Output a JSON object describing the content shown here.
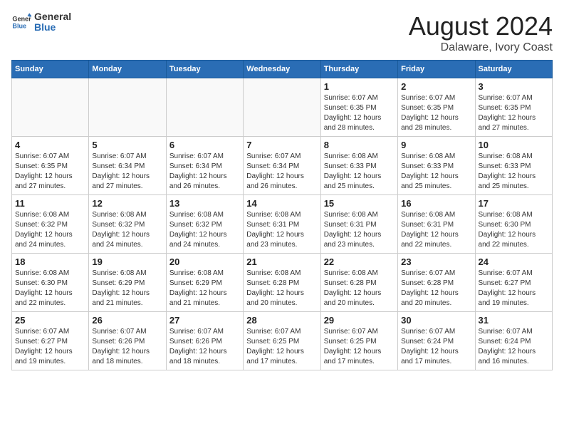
{
  "header": {
    "logo_line1": "General",
    "logo_line2": "Blue",
    "main_title": "August 2024",
    "subtitle": "Dalaware, Ivory Coast"
  },
  "calendar": {
    "weekdays": [
      "Sunday",
      "Monday",
      "Tuesday",
      "Wednesday",
      "Thursday",
      "Friday",
      "Saturday"
    ],
    "weeks": [
      [
        {
          "num": "",
          "info": ""
        },
        {
          "num": "",
          "info": ""
        },
        {
          "num": "",
          "info": ""
        },
        {
          "num": "",
          "info": ""
        },
        {
          "num": "1",
          "info": "Sunrise: 6:07 AM\nSunset: 6:35 PM\nDaylight: 12 hours\nand 28 minutes."
        },
        {
          "num": "2",
          "info": "Sunrise: 6:07 AM\nSunset: 6:35 PM\nDaylight: 12 hours\nand 28 minutes."
        },
        {
          "num": "3",
          "info": "Sunrise: 6:07 AM\nSunset: 6:35 PM\nDaylight: 12 hours\nand 27 minutes."
        }
      ],
      [
        {
          "num": "4",
          "info": "Sunrise: 6:07 AM\nSunset: 6:35 PM\nDaylight: 12 hours\nand 27 minutes."
        },
        {
          "num": "5",
          "info": "Sunrise: 6:07 AM\nSunset: 6:34 PM\nDaylight: 12 hours\nand 27 minutes."
        },
        {
          "num": "6",
          "info": "Sunrise: 6:07 AM\nSunset: 6:34 PM\nDaylight: 12 hours\nand 26 minutes."
        },
        {
          "num": "7",
          "info": "Sunrise: 6:07 AM\nSunset: 6:34 PM\nDaylight: 12 hours\nand 26 minutes."
        },
        {
          "num": "8",
          "info": "Sunrise: 6:08 AM\nSunset: 6:33 PM\nDaylight: 12 hours\nand 25 minutes."
        },
        {
          "num": "9",
          "info": "Sunrise: 6:08 AM\nSunset: 6:33 PM\nDaylight: 12 hours\nand 25 minutes."
        },
        {
          "num": "10",
          "info": "Sunrise: 6:08 AM\nSunset: 6:33 PM\nDaylight: 12 hours\nand 25 minutes."
        }
      ],
      [
        {
          "num": "11",
          "info": "Sunrise: 6:08 AM\nSunset: 6:32 PM\nDaylight: 12 hours\nand 24 minutes."
        },
        {
          "num": "12",
          "info": "Sunrise: 6:08 AM\nSunset: 6:32 PM\nDaylight: 12 hours\nand 24 minutes."
        },
        {
          "num": "13",
          "info": "Sunrise: 6:08 AM\nSunset: 6:32 PM\nDaylight: 12 hours\nand 24 minutes."
        },
        {
          "num": "14",
          "info": "Sunrise: 6:08 AM\nSunset: 6:31 PM\nDaylight: 12 hours\nand 23 minutes."
        },
        {
          "num": "15",
          "info": "Sunrise: 6:08 AM\nSunset: 6:31 PM\nDaylight: 12 hours\nand 23 minutes."
        },
        {
          "num": "16",
          "info": "Sunrise: 6:08 AM\nSunset: 6:31 PM\nDaylight: 12 hours\nand 22 minutes."
        },
        {
          "num": "17",
          "info": "Sunrise: 6:08 AM\nSunset: 6:30 PM\nDaylight: 12 hours\nand 22 minutes."
        }
      ],
      [
        {
          "num": "18",
          "info": "Sunrise: 6:08 AM\nSunset: 6:30 PM\nDaylight: 12 hours\nand 22 minutes."
        },
        {
          "num": "19",
          "info": "Sunrise: 6:08 AM\nSunset: 6:29 PM\nDaylight: 12 hours\nand 21 minutes."
        },
        {
          "num": "20",
          "info": "Sunrise: 6:08 AM\nSunset: 6:29 PM\nDaylight: 12 hours\nand 21 minutes."
        },
        {
          "num": "21",
          "info": "Sunrise: 6:08 AM\nSunset: 6:28 PM\nDaylight: 12 hours\nand 20 minutes."
        },
        {
          "num": "22",
          "info": "Sunrise: 6:08 AM\nSunset: 6:28 PM\nDaylight: 12 hours\nand 20 minutes."
        },
        {
          "num": "23",
          "info": "Sunrise: 6:07 AM\nSunset: 6:28 PM\nDaylight: 12 hours\nand 20 minutes."
        },
        {
          "num": "24",
          "info": "Sunrise: 6:07 AM\nSunset: 6:27 PM\nDaylight: 12 hours\nand 19 minutes."
        }
      ],
      [
        {
          "num": "25",
          "info": "Sunrise: 6:07 AM\nSunset: 6:27 PM\nDaylight: 12 hours\nand 19 minutes."
        },
        {
          "num": "26",
          "info": "Sunrise: 6:07 AM\nSunset: 6:26 PM\nDaylight: 12 hours\nand 18 minutes."
        },
        {
          "num": "27",
          "info": "Sunrise: 6:07 AM\nSunset: 6:26 PM\nDaylight: 12 hours\nand 18 minutes."
        },
        {
          "num": "28",
          "info": "Sunrise: 6:07 AM\nSunset: 6:25 PM\nDaylight: 12 hours\nand 17 minutes."
        },
        {
          "num": "29",
          "info": "Sunrise: 6:07 AM\nSunset: 6:25 PM\nDaylight: 12 hours\nand 17 minutes."
        },
        {
          "num": "30",
          "info": "Sunrise: 6:07 AM\nSunset: 6:24 PM\nDaylight: 12 hours\nand 17 minutes."
        },
        {
          "num": "31",
          "info": "Sunrise: 6:07 AM\nSunset: 6:24 PM\nDaylight: 12 hours\nand 16 minutes."
        }
      ]
    ]
  }
}
